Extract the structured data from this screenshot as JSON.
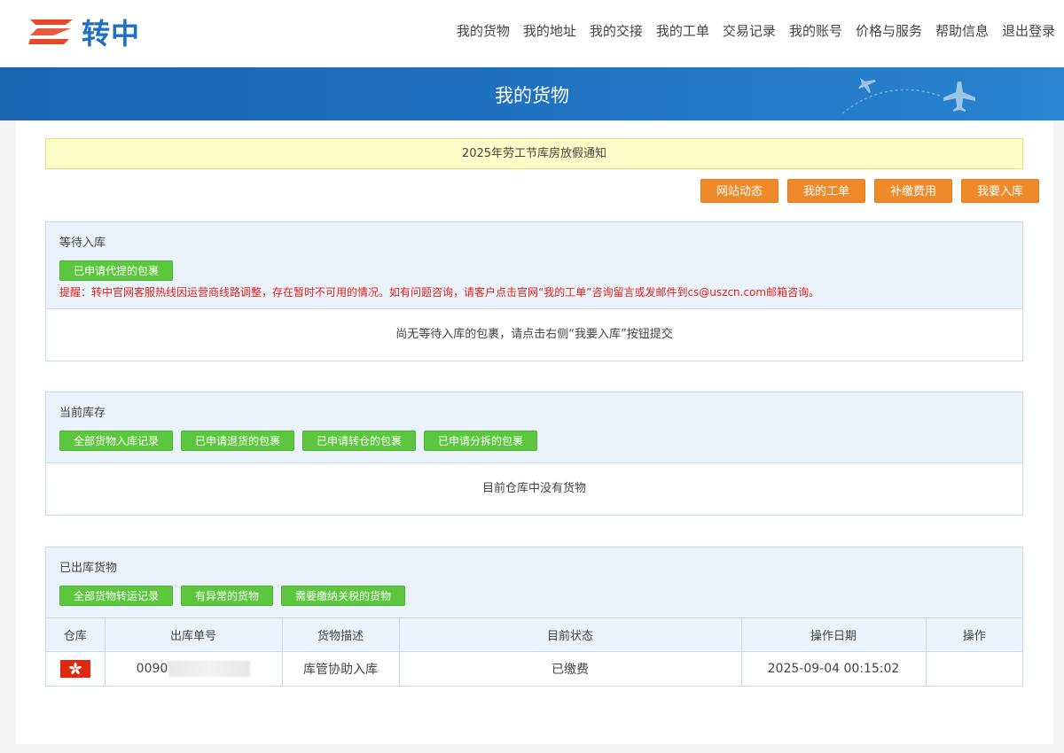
{
  "brand": {
    "name": "转中",
    "accent": "#1e6fc4",
    "logo_color": "#e8482a"
  },
  "nav": {
    "items": [
      "我的货物",
      "我的地址",
      "我的交接",
      "我的工单",
      "交易记录",
      "我的账号",
      "价格与服务",
      "帮助信息",
      "退出登录"
    ]
  },
  "banner": {
    "title": "我的货物"
  },
  "notice": {
    "text": "2025年劳工节库房放假通知"
  },
  "top_actions": [
    "网站动态",
    "我的工单",
    "补缴费用",
    "我要入库"
  ],
  "pending": {
    "title": "等待入库",
    "buttons": [
      "已申请代提的包裹"
    ],
    "warning": "提醒：转中官网客服热线因运营商线路调整，存在暂时不可用的情况。如有问题咨询，请客户点击官网“我的工单”咨询留言或发邮件到cs@uszcn.com邮箱咨询。",
    "empty": "尚无等待入库的包裹，请点击右侧“我要入库”按钮提交"
  },
  "inventory": {
    "title": "当前库存",
    "buttons": [
      "全部货物入库记录",
      "已申请退货的包裹",
      "已申请转仓的包裹",
      "已申请分拆的包裹"
    ],
    "empty": "目前仓库中没有货物"
  },
  "outbound": {
    "title": "已出库货物",
    "buttons": [
      "全部货物转运记录",
      "有异常的货物",
      "需要缴纳关税的货物"
    ],
    "columns": [
      "仓库",
      "出库单号",
      "货物描述",
      "目前状态",
      "操作日期",
      "操作"
    ],
    "rows": [
      {
        "warehouse_icon": "hong-kong-flag-icon",
        "order_no": "0090",
        "description": "库管协助入库",
        "status": "已缴费",
        "date": "2025-09-04 00:15:02",
        "action": ""
      }
    ]
  },
  "colors": {
    "orange_button": "#ee8a2a",
    "green_button": "#5cc73e",
    "banner_blue": "#1a64b0",
    "warning_red": "#e0201a",
    "notice_yellow": "#fdfdc8"
  }
}
